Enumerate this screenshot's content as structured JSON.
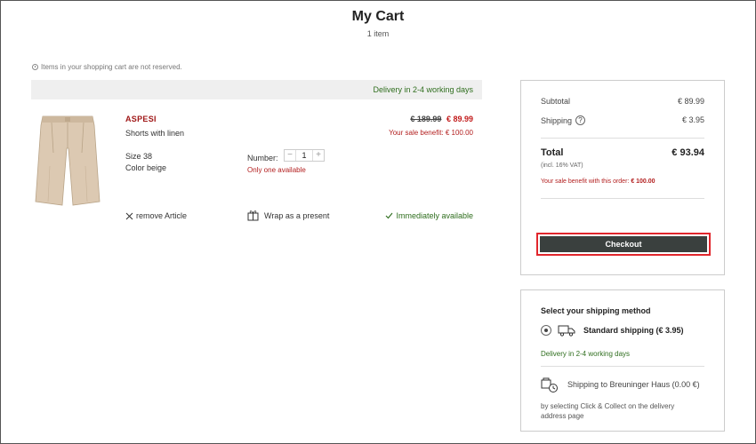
{
  "header": {
    "title": "My Cart",
    "item_count": "1 item"
  },
  "notice": "Items in your shopping cart are not reserved.",
  "delivery_bar": "Delivery in 2-4 working days",
  "item": {
    "brand": "ASPESI",
    "name": "Shorts with linen",
    "size": "Size 38",
    "color": "Color beige",
    "old_price": "€ 189.99",
    "price": "€ 89.99",
    "sale_benefit": "Your sale benefit: € 100.00",
    "number_label": "Number:",
    "quantity": "1",
    "stock_note": "Only one available",
    "remove_label": "remove Article",
    "wrap_label": "Wrap as a present",
    "availability": "Immediately available"
  },
  "summary": {
    "subtotal_label": "Subtotal",
    "subtotal": "€ 89.99",
    "shipping_label": "Shipping",
    "shipping": "€ 3.95",
    "total_label": "Total",
    "total": "€ 93.94",
    "vat_note": "(incl. 16% VAT)",
    "sale_benefit_label": "Your sale benefit with this order:",
    "sale_benefit_value": "€ 100.00",
    "checkout_label": "Checkout"
  },
  "shipping_method": {
    "title": "Select your shipping method",
    "standard_label": "Standard shipping (€ 3.95)",
    "standard_delivery": "Delivery in 2-4 working days",
    "store_label": "Shipping to Breuninger Haus (0.00 €)",
    "store_note": "by selecting Click & Collect on the delivery address page"
  },
  "colors": {
    "brand_red": "#a01818",
    "sale_red": "#c21b1b",
    "green": "#2f6e1e",
    "checkout_bg": "#3a403e",
    "highlight": "#e1262c"
  },
  "icons": [
    "clock-icon",
    "close-icon",
    "gift-icon",
    "checkmark-icon",
    "question-icon",
    "truck-icon",
    "store-icon"
  ]
}
